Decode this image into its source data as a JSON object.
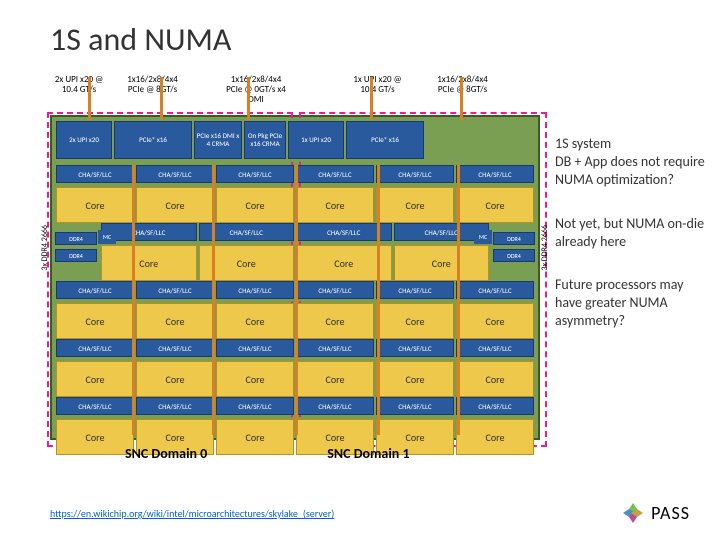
{
  "title": "1S and NUMA",
  "top_labels": {
    "l0": "2x UPI x20 @ 10.4 GT/s",
    "l1": "1x16/2x8/4x4 PCIe @ 8GT/s",
    "l2": "1x16/2x8/4x4 PCIe @ 0GT/s x4 DMI",
    "l3": "1x UPI x20 @ 10.4 GT/s",
    "l4": "1x16/2x8/4x4 PCIe @ 8GT/s"
  },
  "boxes": {
    "upi2": "2x UPI x20",
    "pcie16": "PCIe* x16",
    "dmi": "PCIe x16 DMI x 4 CRMA",
    "onpkg": "On Pkg PCIe x16 CRMA",
    "upi1": "1x UPI x20"
  },
  "cha": "CHA/SF/LLC",
  "core": "Core",
  "mc": "MC",
  "ddr": "DDR4",
  "side_label": "3x DDR4 2666",
  "snc0": "SNC Domain 0",
  "snc1": "SNC Domain 1",
  "notes": {
    "n1": "1S system\nDB + App does not require NUMA optimization?",
    "n2": "Not yet, but NUMA on-die already here",
    "n3": "Future processors may have greater NUMA asymmetry?"
  },
  "link": "https://en.wikichip.org/wiki/intel/microarchitectures/skylake_(server)",
  "logo": "PASS"
}
